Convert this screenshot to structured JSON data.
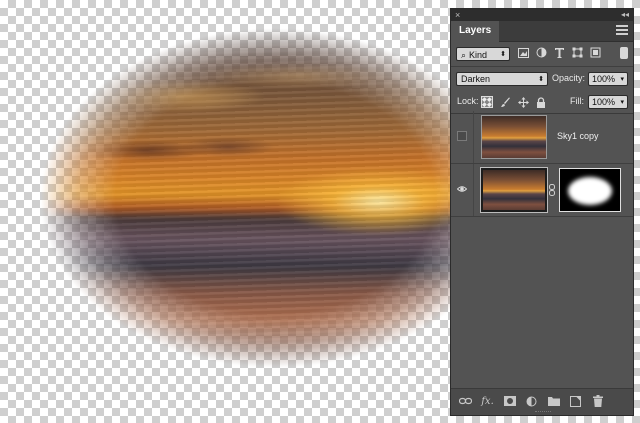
{
  "panel": {
    "close_glyph": "×",
    "collapse_glyph": "◂◂",
    "tab": "Layers",
    "filter": {
      "kind_label": "Kind",
      "icons": [
        "image-filter-icon",
        "adjustment-filter-icon",
        "type-filter-icon",
        "shape-filter-icon",
        "smart-object-filter-icon"
      ]
    },
    "blend_mode": "Darken",
    "opacity_label": "Opacity:",
    "opacity_value": "100%",
    "lock_label": "Lock:",
    "fill_label": "Fill:",
    "fill_value": "100%",
    "layers": [
      {
        "name": "Sky1 copy",
        "visible": false,
        "has_mask": false
      },
      {
        "name": "",
        "visible": true,
        "has_mask": true,
        "selected": true
      }
    ],
    "bottom_icons": [
      "link-layers-icon",
      "fx-icon",
      "add-mask-icon",
      "adjustment-layer-icon",
      "new-group-icon",
      "new-layer-icon",
      "delete-layer-icon"
    ],
    "fx_label": "fx."
  }
}
